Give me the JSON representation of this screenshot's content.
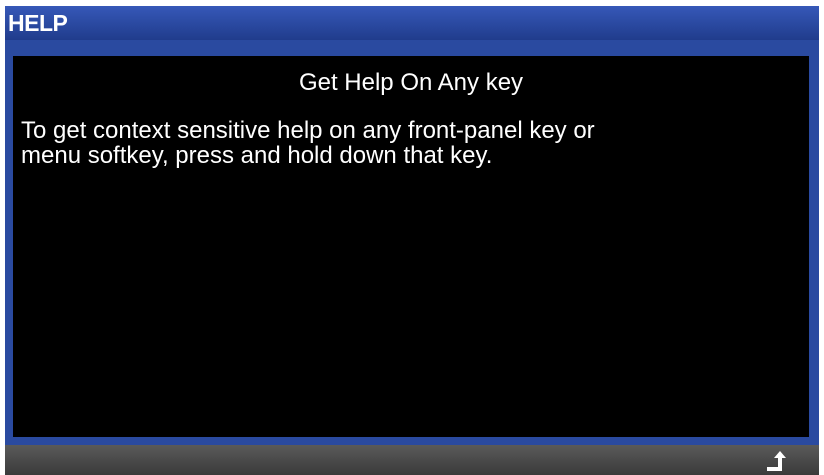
{
  "window": {
    "title": "HELP"
  },
  "help": {
    "heading": "Get Help On Any key",
    "body_line1": "To get context sensitive help on any front-panel key or",
    "body_line2": "menu softkey, press and hold down that key."
  },
  "softkeys": {
    "return_icon": "return-arrow-icon"
  },
  "colors": {
    "title_bar": "#2a4aa0",
    "content_background": "#000000",
    "text": "#ffffff",
    "softkey_bar": "#4a4a4a"
  }
}
